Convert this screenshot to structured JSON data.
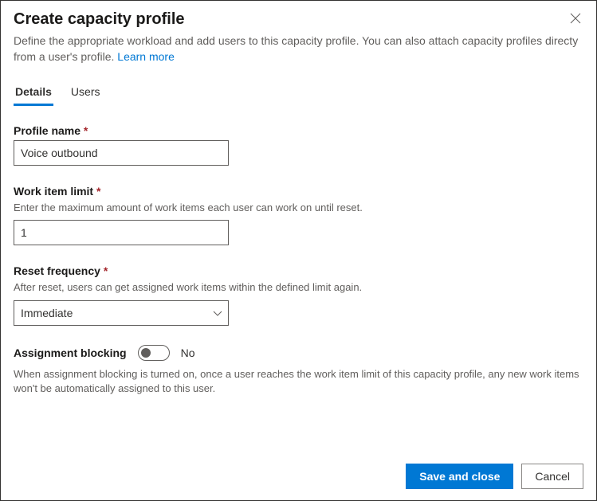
{
  "header": {
    "title": "Create capacity profile",
    "description_part1": "Define the appropriate workload and add users to this capacity profile. You can also attach capacity profiles directy from a user's profile. ",
    "learn_more": "Learn more"
  },
  "tabs": {
    "details": "Details",
    "users": "Users"
  },
  "fields": {
    "profile_name": {
      "label": "Profile name",
      "value": "Voice outbound"
    },
    "work_item_limit": {
      "label": "Work item limit",
      "help": "Enter the maximum amount of work items each user can work on until reset.",
      "value": "1"
    },
    "reset_frequency": {
      "label": "Reset frequency",
      "help": "After reset, users can get assigned work items within the defined limit again.",
      "value": "Immediate"
    },
    "assignment_blocking": {
      "label": "Assignment blocking",
      "state": "No",
      "help": "When assignment blocking is turned on, once a user reaches the work item limit of this capacity profile, any new work items won't be automatically assigned to this user."
    }
  },
  "footer": {
    "save": "Save and close",
    "cancel": "Cancel"
  }
}
